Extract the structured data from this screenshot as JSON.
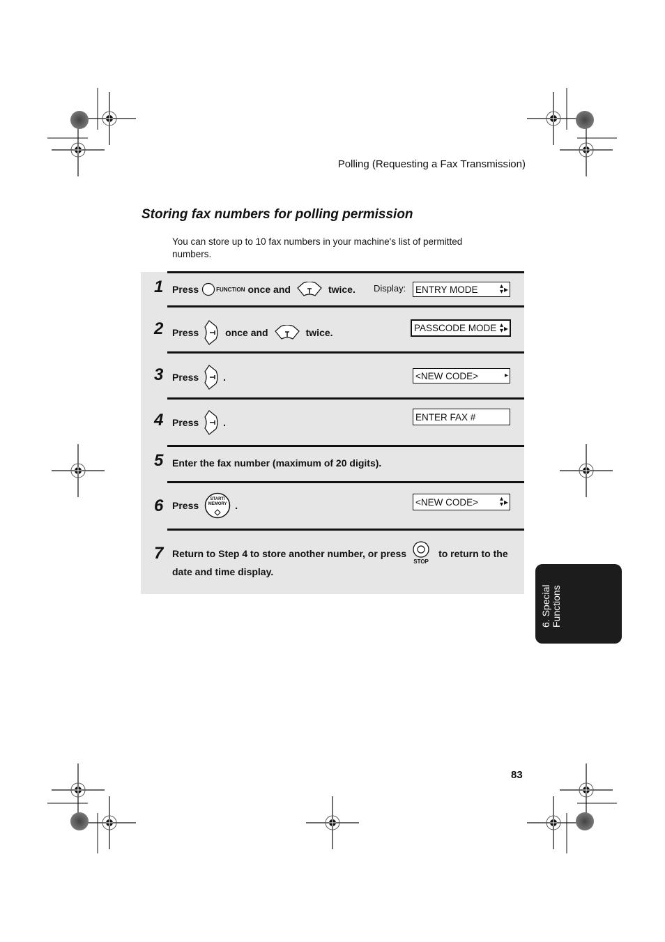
{
  "header": {
    "running_title": "Polling (Requesting a Fax Transmission)"
  },
  "section": {
    "title": "Storing fax numbers for polling permission",
    "intro": "You can store up to 10 fax numbers in your machine's list of permitted numbers."
  },
  "display_label": "Display:",
  "steps": [
    {
      "number": "1",
      "parts": [
        "Press",
        "FUNCTION",
        "once and",
        "twice."
      ],
      "display": "ENTRY MODE",
      "display_arrows": "up-down-right"
    },
    {
      "number": "2",
      "parts": [
        "Press",
        "once and",
        "twice."
      ],
      "display": "PASSCODE MODE",
      "display_arrows": "up-down-right"
    },
    {
      "number": "3",
      "parts": [
        "Press",
        "."
      ],
      "display": "<NEW CODE>",
      "display_arrows": "right"
    },
    {
      "number": "4",
      "parts": [
        "Press",
        "."
      ],
      "display": "ENTER FAX #"
    },
    {
      "number": "5",
      "text": "Enter the fax number (maximum of 20 digits)."
    },
    {
      "number": "6",
      "parts": [
        "Press",
        "."
      ],
      "button_label_1": "START/",
      "button_label_2": "MEMORY",
      "display": "<NEW CODE>",
      "display_arrows": "up-down-right"
    },
    {
      "number": "7",
      "text_a": "Return to Step 4 to store another number, or press",
      "stop_label": "STOP",
      "text_b": "to return to the",
      "text_c": "date and time display."
    }
  ],
  "side_tab": {
    "line1": "6. Special",
    "line2": "Functions"
  },
  "page_number": "83",
  "icons": {
    "function_key": "circle-button-icon",
    "down_arrow_key": "down-arrow-key-icon",
    "right_arrow_key": "right-arrow-key-icon",
    "start_memory_key": "start-memory-button-icon",
    "stop_key": "stop-button-icon"
  }
}
